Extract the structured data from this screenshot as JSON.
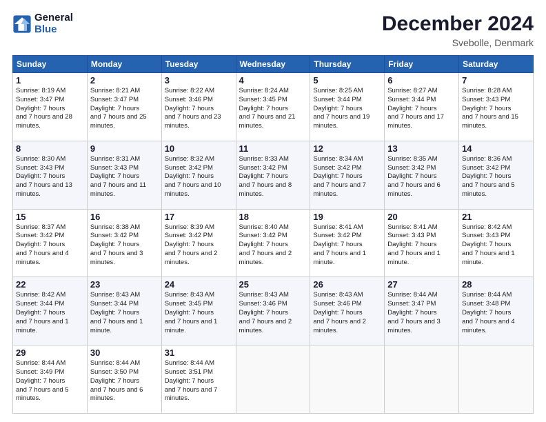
{
  "header": {
    "logo_general": "General",
    "logo_blue": "Blue",
    "month_title": "December 2024",
    "location": "Svebolle, Denmark"
  },
  "days_of_week": [
    "Sunday",
    "Monday",
    "Tuesday",
    "Wednesday",
    "Thursday",
    "Friday",
    "Saturday"
  ],
  "weeks": [
    [
      {
        "day": "1",
        "sunrise": "8:19 AM",
        "sunset": "3:47 PM",
        "daylight": "7 hours and 28 minutes."
      },
      {
        "day": "2",
        "sunrise": "8:21 AM",
        "sunset": "3:47 PM",
        "daylight": "7 hours and 25 minutes."
      },
      {
        "day": "3",
        "sunrise": "8:22 AM",
        "sunset": "3:46 PM",
        "daylight": "7 hours and 23 minutes."
      },
      {
        "day": "4",
        "sunrise": "8:24 AM",
        "sunset": "3:45 PM",
        "daylight": "7 hours and 21 minutes."
      },
      {
        "day": "5",
        "sunrise": "8:25 AM",
        "sunset": "3:44 PM",
        "daylight": "7 hours and 19 minutes."
      },
      {
        "day": "6",
        "sunrise": "8:27 AM",
        "sunset": "3:44 PM",
        "daylight": "7 hours and 17 minutes."
      },
      {
        "day": "7",
        "sunrise": "8:28 AM",
        "sunset": "3:43 PM",
        "daylight": "7 hours and 15 minutes."
      }
    ],
    [
      {
        "day": "8",
        "sunrise": "8:30 AM",
        "sunset": "3:43 PM",
        "daylight": "7 hours and 13 minutes."
      },
      {
        "day": "9",
        "sunrise": "8:31 AM",
        "sunset": "3:43 PM",
        "daylight": "7 hours and 11 minutes."
      },
      {
        "day": "10",
        "sunrise": "8:32 AM",
        "sunset": "3:42 PM",
        "daylight": "7 hours and 10 minutes."
      },
      {
        "day": "11",
        "sunrise": "8:33 AM",
        "sunset": "3:42 PM",
        "daylight": "7 hours and 8 minutes."
      },
      {
        "day": "12",
        "sunrise": "8:34 AM",
        "sunset": "3:42 PM",
        "daylight": "7 hours and 7 minutes."
      },
      {
        "day": "13",
        "sunrise": "8:35 AM",
        "sunset": "3:42 PM",
        "daylight": "7 hours and 6 minutes."
      },
      {
        "day": "14",
        "sunrise": "8:36 AM",
        "sunset": "3:42 PM",
        "daylight": "7 hours and 5 minutes."
      }
    ],
    [
      {
        "day": "15",
        "sunrise": "8:37 AM",
        "sunset": "3:42 PM",
        "daylight": "7 hours and 4 minutes."
      },
      {
        "day": "16",
        "sunrise": "8:38 AM",
        "sunset": "3:42 PM",
        "daylight": "7 hours and 3 minutes."
      },
      {
        "day": "17",
        "sunrise": "8:39 AM",
        "sunset": "3:42 PM",
        "daylight": "7 hours and 2 minutes."
      },
      {
        "day": "18",
        "sunrise": "8:40 AM",
        "sunset": "3:42 PM",
        "daylight": "7 hours and 2 minutes."
      },
      {
        "day": "19",
        "sunrise": "8:41 AM",
        "sunset": "3:42 PM",
        "daylight": "7 hours and 1 minute."
      },
      {
        "day": "20",
        "sunrise": "8:41 AM",
        "sunset": "3:43 PM",
        "daylight": "7 hours and 1 minute."
      },
      {
        "day": "21",
        "sunrise": "8:42 AM",
        "sunset": "3:43 PM",
        "daylight": "7 hours and 1 minute."
      }
    ],
    [
      {
        "day": "22",
        "sunrise": "8:42 AM",
        "sunset": "3:44 PM",
        "daylight": "7 hours and 1 minute."
      },
      {
        "day": "23",
        "sunrise": "8:43 AM",
        "sunset": "3:44 PM",
        "daylight": "7 hours and 1 minute."
      },
      {
        "day": "24",
        "sunrise": "8:43 AM",
        "sunset": "3:45 PM",
        "daylight": "7 hours and 1 minute."
      },
      {
        "day": "25",
        "sunrise": "8:43 AM",
        "sunset": "3:46 PM",
        "daylight": "7 hours and 2 minutes."
      },
      {
        "day": "26",
        "sunrise": "8:43 AM",
        "sunset": "3:46 PM",
        "daylight": "7 hours and 2 minutes."
      },
      {
        "day": "27",
        "sunrise": "8:44 AM",
        "sunset": "3:47 PM",
        "daylight": "7 hours and 3 minutes."
      },
      {
        "day": "28",
        "sunrise": "8:44 AM",
        "sunset": "3:48 PM",
        "daylight": "7 hours and 4 minutes."
      }
    ],
    [
      {
        "day": "29",
        "sunrise": "8:44 AM",
        "sunset": "3:49 PM",
        "daylight": "7 hours and 5 minutes."
      },
      {
        "day": "30",
        "sunrise": "8:44 AM",
        "sunset": "3:50 PM",
        "daylight": "7 hours and 6 minutes."
      },
      {
        "day": "31",
        "sunrise": "8:44 AM",
        "sunset": "3:51 PM",
        "daylight": "7 hours and 7 minutes."
      },
      null,
      null,
      null,
      null
    ]
  ]
}
